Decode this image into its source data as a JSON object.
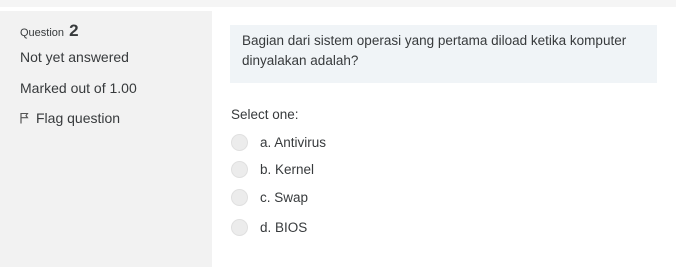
{
  "info": {
    "question_label": "Question",
    "question_number": "2",
    "state": "Not yet answered",
    "grade": "Marked out of 1.00",
    "flag_label": "Flag question"
  },
  "question": {
    "text": "Bagian dari sistem operasi yang pertama diload ketika komputer dinyalakan adalah?",
    "prompt": "Select one:",
    "options": [
      {
        "label": "a. Antivirus"
      },
      {
        "label": "b. Kernel"
      },
      {
        "label": "c. Swap"
      },
      {
        "label": "d. BIOS"
      }
    ]
  }
}
